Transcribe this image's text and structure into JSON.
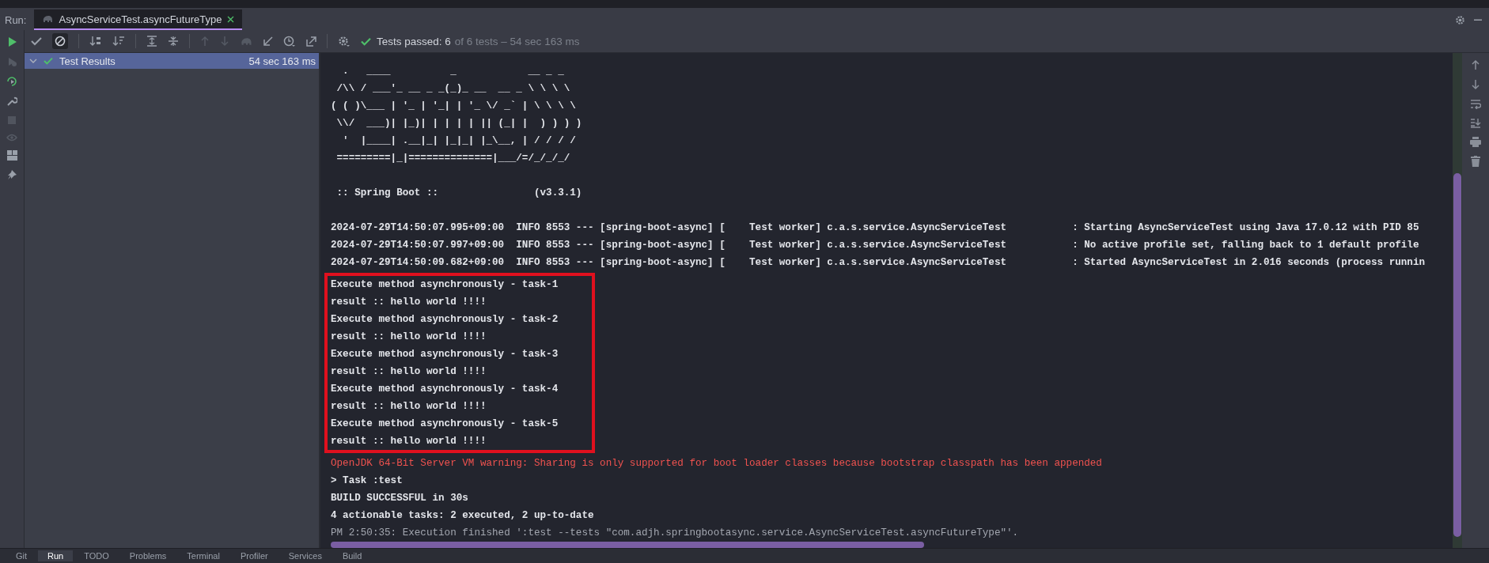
{
  "run_bar": {
    "label": "Run:",
    "tabs": [
      {
        "title": "AsyncServiceTest.asyncFutureType",
        "selected": true
      }
    ]
  },
  "toolbar": {
    "status_main": "Tests passed: 6",
    "status_rest": "of 6 tests – 54 sec 163 ms"
  },
  "tree": [
    {
      "label": "Test Results",
      "time": "54 sec 163 ms",
      "selected": true,
      "expanded": true,
      "passed": true
    }
  ],
  "console": {
    "banner": [
      "  .   ____          _            __ _ _",
      " /\\\\ / ___'_ __ _ _(_)_ __  __ _ \\ \\ \\ \\",
      "( ( )\\___ | '_ | '_| | '_ \\/ _` | \\ \\ \\ \\",
      " \\\\/  ___)| |_)| | | | | || (_| |  ) ) ) )",
      "  '  |____| .__|_| |_|_| |_\\__, | / / / /",
      " =========|_|==============|___/=/_/_/_/"
    ],
    "version_line": " :: Spring Boot ::                (v3.3.1)",
    "lines_before": [
      {
        "kind": "normal",
        "text": "2024-07-29T14:50:07.995+09:00  INFO 8553 --- [spring-boot-async] [    Test worker] c.a.s.service.AsyncServiceTest           : Starting AsyncServiceTest using Java 17.0.12 with PID 85"
      },
      {
        "kind": "normal",
        "text": "2024-07-29T14:50:07.997+09:00  INFO 8553 --- [spring-boot-async] [    Test worker] c.a.s.service.AsyncServiceTest           : No active profile set, falling back to 1 default profile"
      },
      {
        "kind": "normal",
        "text": "2024-07-29T14:50:09.682+09:00  INFO 8553 --- [spring-boot-async] [    Test worker] c.a.s.service.AsyncServiceTest           : Started AsyncServiceTest in 2.016 seconds (process runnin"
      }
    ],
    "highlighted_lines": [
      {
        "kind": "normal",
        "text": "Execute method asynchronously - task-1"
      },
      {
        "kind": "normal",
        "text": "result :: hello world !!!!"
      },
      {
        "kind": "normal",
        "text": "Execute method asynchronously - task-2"
      },
      {
        "kind": "normal",
        "text": "result :: hello world !!!!"
      },
      {
        "kind": "normal",
        "text": "Execute method asynchronously - task-3"
      },
      {
        "kind": "normal",
        "text": "result :: hello world !!!!"
      },
      {
        "kind": "normal",
        "text": "Execute method asynchronously - task-4"
      },
      {
        "kind": "normal",
        "text": "result :: hello world !!!!"
      },
      {
        "kind": "normal",
        "text": "Execute method asynchronously - task-5"
      },
      {
        "kind": "normal",
        "text": "result :: hello world !!!!"
      }
    ],
    "lines_after": [
      {
        "kind": "error",
        "text": "OpenJDK 64-Bit Server VM warning: Sharing is only supported for boot loader classes because bootstrap classpath has been appended"
      },
      {
        "kind": "normal",
        "text": "> Task :test"
      },
      {
        "kind": "normal",
        "text": "BUILD SUCCESSFUL in 30s"
      },
      {
        "kind": "normal",
        "text": "4 actionable tasks: 2 executed, 2 up-to-date"
      },
      {
        "kind": "muted",
        "text": "PM 2:50:35: Execution finished ':test --tests \"com.adjh.springbootasync.service.AsyncServiceTest.asyncFutureType\"'."
      }
    ]
  },
  "bottom_bar": [
    {
      "label": "Git",
      "selected": false
    },
    {
      "label": "Run",
      "selected": true
    },
    {
      "label": "TODO",
      "selected": false
    },
    {
      "label": "Problems",
      "selected": false
    },
    {
      "label": "Terminal",
      "selected": false
    },
    {
      "label": "Profiler",
      "selected": false
    },
    {
      "label": "Services",
      "selected": false
    },
    {
      "label": "Build",
      "selected": false
    }
  ]
}
